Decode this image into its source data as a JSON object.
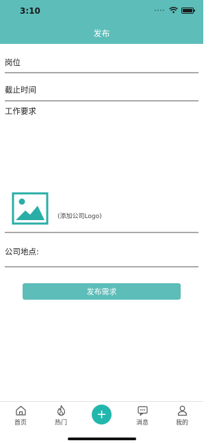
{
  "status_bar": {
    "time": "3:10"
  },
  "header": {
    "title": "发布"
  },
  "form": {
    "position_label": "岗位",
    "deadline_label": "截止时间",
    "requirements_label": "工作要求",
    "logo_hint": "(添加公司Logo)",
    "address_label": "公司地点:",
    "submit_label": "发布需求"
  },
  "tabbar": {
    "items": [
      {
        "label": "首页",
        "icon": "home-icon"
      },
      {
        "label": "热门",
        "icon": "flame-icon"
      },
      {
        "label": "+",
        "icon": "plus-icon"
      },
      {
        "label": "消息",
        "icon": "message-icon"
      },
      {
        "label": "我的",
        "icon": "user-icon"
      }
    ]
  },
  "colors": {
    "accent": "#5cbdb9",
    "center_button": "#22b7ac"
  }
}
